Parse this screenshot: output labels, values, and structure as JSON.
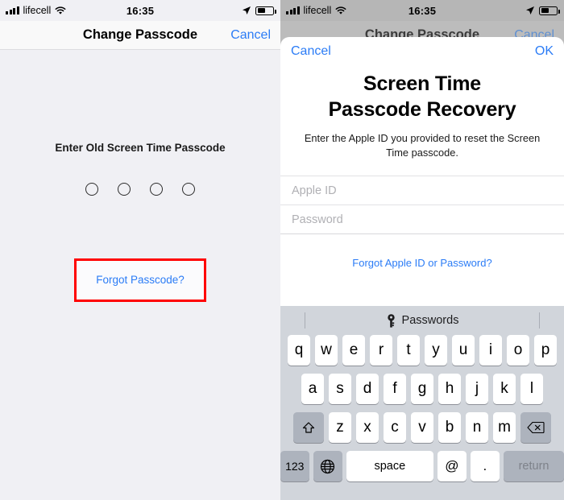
{
  "left_phone": {
    "status_bar": {
      "carrier": "lifecell",
      "time": "16:35",
      "signal_icon": "signal-bars-icon",
      "wifi_icon": "wifi-icon",
      "location_icon": "location-arrow-icon",
      "battery_icon": "battery-icon",
      "battery_level_percent": 44
    },
    "nav_bar": {
      "title": "Change Passcode",
      "cancel_label": "Cancel"
    },
    "content": {
      "prompt": "Enter Old Screen Time Passcode",
      "passcode_dots": 4,
      "forgot_passcode_label": "Forgot Passcode?"
    },
    "annotation": {
      "highlight_color": "#ff0000",
      "target": "Forgot Passcode?"
    }
  },
  "right_phone": {
    "status_bar": {
      "carrier": "lifecell",
      "time": "16:35",
      "signal_icon": "signal-bars-icon",
      "wifi_icon": "wifi-icon",
      "location_icon": "location-arrow-icon",
      "battery_icon": "battery-icon",
      "battery_level_percent": 44
    },
    "nav_bar": {
      "title": "Change Passcode",
      "cancel_label": "Cancel"
    },
    "sheet": {
      "cancel_label": "Cancel",
      "ok_label": "OK",
      "title_line1": "Screen Time",
      "title_line2": "Passcode Recovery",
      "subtitle": "Enter the Apple ID you provided to reset the Screen Time passcode.",
      "fields": [
        {
          "name": "apple-id",
          "placeholder": "Apple ID",
          "value": ""
        },
        {
          "name": "password",
          "placeholder": "Password",
          "value": ""
        }
      ],
      "forgot_link": "Forgot Apple ID or Password?"
    },
    "keyboard": {
      "toolbar": {
        "key_icon": "key-icon",
        "passwords_label": "Passwords"
      },
      "row1": [
        "q",
        "w",
        "e",
        "r",
        "t",
        "y",
        "u",
        "i",
        "o",
        "p"
      ],
      "row2": [
        "a",
        "s",
        "d",
        "f",
        "g",
        "h",
        "j",
        "k",
        "l"
      ],
      "row3": [
        "z",
        "x",
        "c",
        "v",
        "b",
        "n",
        "m"
      ],
      "shift_icon": "shift-arrow-icon",
      "delete_icon": "backspace-icon",
      "numbers_label": "123",
      "globe_icon": "globe-icon",
      "space_label": "space",
      "at_label": "@",
      "period_label": ".",
      "return_label": "return"
    }
  },
  "colors": {
    "accent_blue": "#2b7cf6",
    "annotation_red": "#ff0000",
    "keyboard_bg": "#d1d5db",
    "screen_bg": "#f0f0f4"
  }
}
